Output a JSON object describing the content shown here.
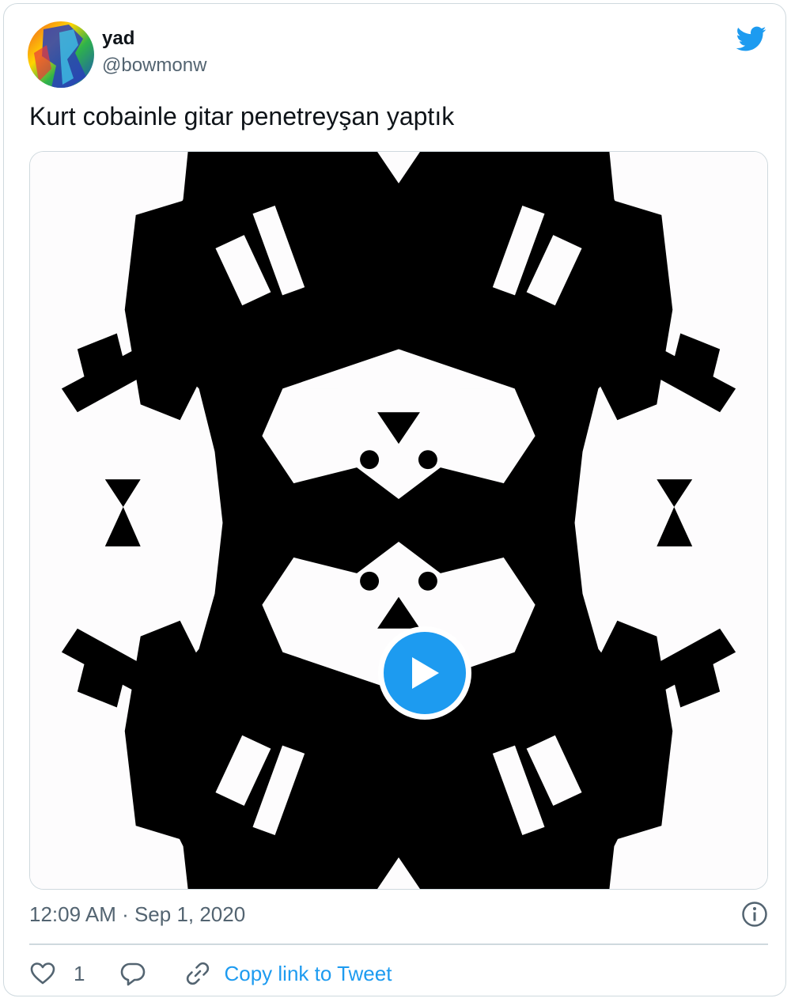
{
  "tweet": {
    "display_name": "yad",
    "handle": "@bowmonw",
    "text": "Kurt cobainle gitar penetreyşan yaptık",
    "timestamp": "12:09 AM · Sep 1, 2020",
    "like_count": "1",
    "copy_link_label": "Copy link to Tweet"
  },
  "icons": {
    "brand": "twitter-bird-icon",
    "play": "play-icon",
    "info": "info-icon",
    "like": "heart-icon",
    "reply": "reply-icon",
    "link": "link-icon"
  },
  "colors": {
    "accent": "#1d9bf0",
    "text": "#0f1419",
    "secondary": "#536471",
    "border": "#cfd9de"
  }
}
